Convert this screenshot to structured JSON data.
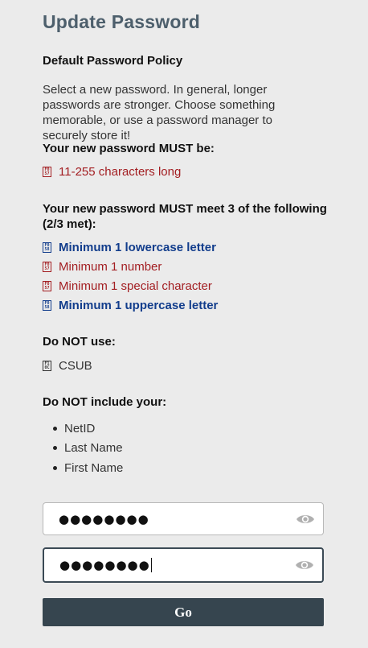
{
  "page": {
    "title": "Update Password"
  },
  "policy": {
    "heading": "Default Password Policy",
    "intro": "Select a new password. In general, longer passwords are stronger. Choose something memorable, or use a password manager to securely store it!"
  },
  "must_be": {
    "heading": "Your new password MUST be:",
    "rules": [
      {
        "label": "11-255 characters long",
        "status": "fail",
        "icon": "fail-icon"
      }
    ]
  },
  "must_meet": {
    "heading": "Your new password MUST meet 3 of the following (2/3 met):",
    "rules": [
      {
        "label": "Minimum 1 lowercase letter",
        "status": "pass",
        "icon": "pass-icon"
      },
      {
        "label": "Minimum 1 number",
        "status": "fail",
        "icon": "fail-icon"
      },
      {
        "label": "Minimum 1 special character",
        "status": "fail",
        "icon": "fail-icon"
      },
      {
        "label": "Minimum 1 uppercase letter",
        "status": "pass",
        "icon": "pass-icon"
      }
    ]
  },
  "do_not_use": {
    "heading": "Do NOT use:",
    "items": [
      {
        "label": "CSUB",
        "icon": "info-icon"
      }
    ]
  },
  "do_not_include": {
    "heading": "Do NOT include your:",
    "items": [
      "NetID",
      "Last Name",
      "First Name"
    ]
  },
  "form": {
    "new_password_value": "●●●●●●●●",
    "confirm_password_value": "●●●●●●●●",
    "submit_label": "Go"
  },
  "colors": {
    "fail": "#a31e22",
    "pass": "#123d8c",
    "button": "#36454f",
    "title": "#4d5f6c"
  }
}
